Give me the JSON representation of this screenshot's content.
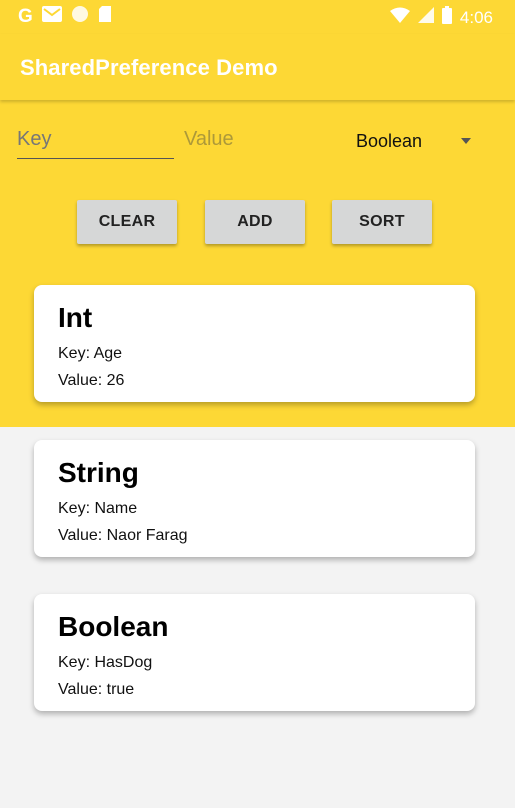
{
  "status_bar": {
    "time": "4:06",
    "icons": [
      "google-icon",
      "gmail-icon",
      "circle-icon",
      "sd-card-icon",
      "wifi-icon",
      "signal-icon",
      "battery-icon"
    ]
  },
  "app_bar": {
    "title": "SharedPreference Demo"
  },
  "form": {
    "key_placeholder": "Key",
    "value_placeholder": "Value",
    "type_selected": "Boolean"
  },
  "buttons": {
    "clear": "CLEAR",
    "add": "ADD",
    "sort": "SORT"
  },
  "cards": [
    {
      "type": "Int",
      "key": "Key: Age",
      "value": "Value: 26"
    },
    {
      "type": "String",
      "key": "Key: Name",
      "value": "Value: Naor Farag"
    },
    {
      "type": "Boolean",
      "key": "Key: HasDog",
      "value": "Value: true"
    }
  ],
  "colors": {
    "primary": "#fdd835",
    "background": "#f3f3f3",
    "button": "#d6d7d7"
  }
}
